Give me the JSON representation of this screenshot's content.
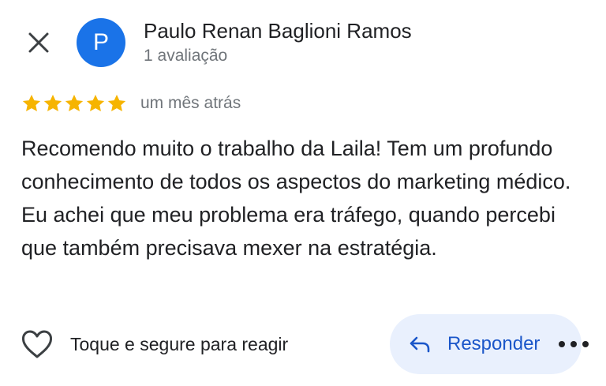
{
  "header": {
    "close_icon": "close-icon",
    "avatar_letter": "P",
    "avatar_color": "#1a73e8",
    "author_name": "Paulo Renan Baglioni Ramos",
    "author_meta": "1 avaliação"
  },
  "review": {
    "rating": 5,
    "rating_max": 5,
    "star_color": "#f6b400",
    "time": "um mês atrás",
    "text": "Recomendo muito o trabalho da Laila! Tem um profundo conhecimento de todos os aspectos do marketing médico. Eu achei que meu problema era tráfego, quando percebi que também precisava mexer na estratégia."
  },
  "actions": {
    "react_icon": "heart-outline-icon",
    "react_label": "Toque e segure para reagir",
    "reply_icon": "reply-arrow-icon",
    "reply_label": "Responder",
    "reply_color": "#1a56c9",
    "more_icon": "more-horizontal-icon"
  }
}
